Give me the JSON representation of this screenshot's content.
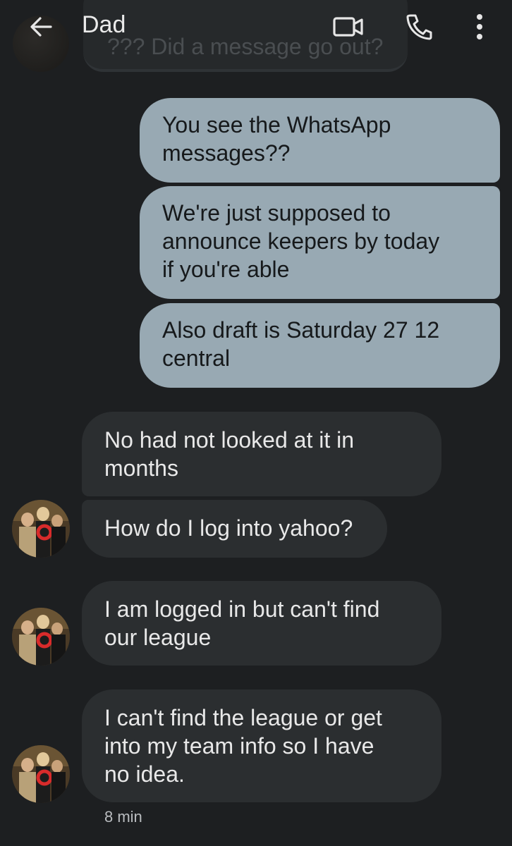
{
  "header": {
    "title": "Dad",
    "back_icon": "arrow-left-icon",
    "video_icon": "video-call-icon",
    "call_icon": "phone-icon",
    "more_icon": "more-vertical-icon"
  },
  "previous_message": {
    "text": "??? Did  a message go out?"
  },
  "messages": [
    {
      "direction": "outgoing",
      "text": "You see the WhatsApp\nmessages??"
    },
    {
      "direction": "outgoing",
      "text": "We're just supposed to\nannounce keepers by today\nif you're able"
    },
    {
      "direction": "outgoing",
      "text": "Also draft is Saturday 27 12\ncentral"
    },
    {
      "direction": "incoming",
      "text": "No had not looked at it in\nmonths"
    },
    {
      "direction": "incoming",
      "text": "How do I log into yahoo?"
    },
    {
      "direction": "incoming",
      "text": "I am logged in but can't find\nour league"
    },
    {
      "direction": "incoming",
      "text": "I can't find the league or get\ninto my team info so I have\nno idea."
    }
  ],
  "last_timestamp": "8 min",
  "colors": {
    "background": "#1d1f21",
    "outgoing_bubble": "#98a9b3",
    "incoming_bubble": "#2b2e30"
  }
}
